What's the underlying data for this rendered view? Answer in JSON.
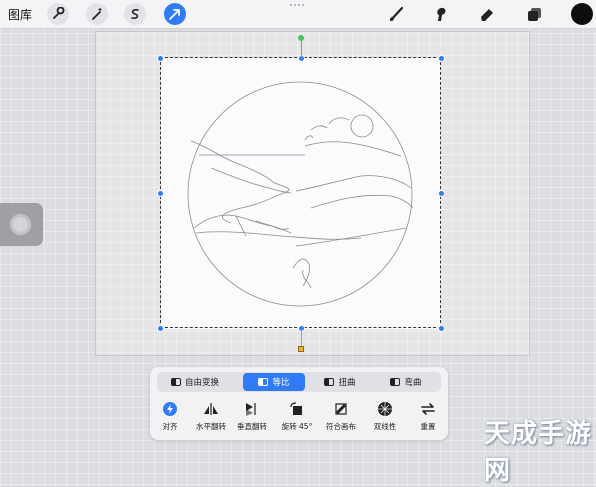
{
  "topbar": {
    "gallery_label": "图库",
    "tools_left": [
      "wrench-icon",
      "magic-wand-icon",
      "selection-s-icon",
      "transform-arrow-icon"
    ],
    "tools_right": [
      "brush-icon",
      "smudge-icon",
      "eraser-icon",
      "layers-icon"
    ],
    "color": "#0d0d0d"
  },
  "colors": {
    "accent": "#2f7cf6",
    "rotate_handle": "#46c45a",
    "pivot_handle": "#f1b524"
  },
  "transform": {
    "modes": [
      {
        "label": "自由变换",
        "active": false
      },
      {
        "label": "等比",
        "active": true
      },
      {
        "label": "扭曲",
        "active": false
      },
      {
        "label": "弯曲",
        "active": false
      }
    ],
    "actions": [
      {
        "label": "对齐",
        "icon": "snap-lightning-icon"
      },
      {
        "label": "水平翻转",
        "icon": "flip-horizontal-icon"
      },
      {
        "label": "垂直翻转",
        "icon": "flip-vertical-icon"
      },
      {
        "label": "旋转 45°",
        "icon": "rotate-45-icon"
      },
      {
        "label": "符合画布",
        "icon": "fit-canvas-icon"
      },
      {
        "label": "双线性",
        "icon": "bilinear-icon"
      },
      {
        "label": "重置",
        "icon": "reset-icon"
      }
    ]
  },
  "watermark": "天成手游网"
}
